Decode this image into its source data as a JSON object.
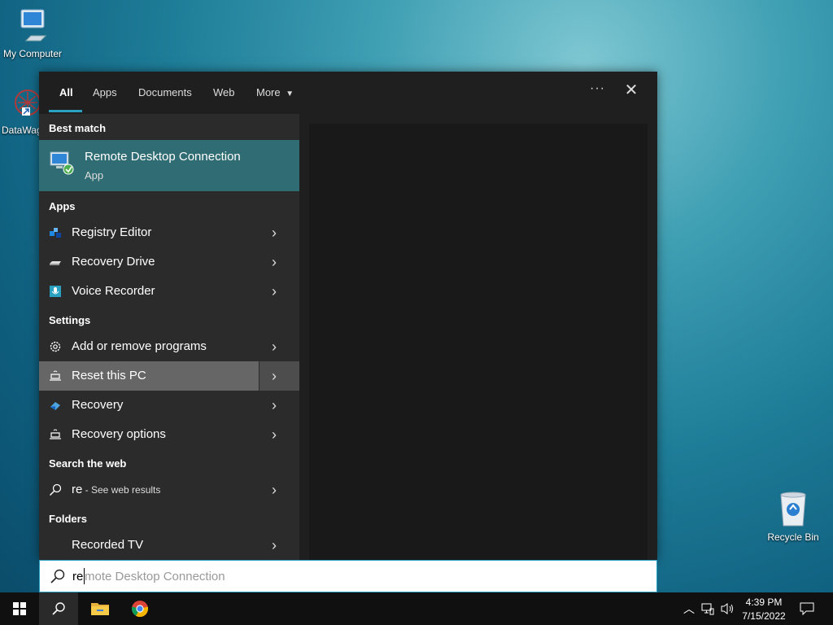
{
  "desktop": {
    "icons": [
      {
        "label": "My Computer"
      },
      {
        "label": "DataWag"
      },
      {
        "label": "Recycle Bin"
      }
    ]
  },
  "search_panel": {
    "tabs": [
      {
        "label": "All",
        "active": true
      },
      {
        "label": "Apps"
      },
      {
        "label": "Documents"
      },
      {
        "label": "Web"
      },
      {
        "label": "More"
      }
    ],
    "more_options_glyph": "···",
    "close_glyph": "✕",
    "best_match": {
      "heading": "Best match",
      "title": "Remote Desktop Connection",
      "subtitle": "App",
      "icon": "remote-desktop-icon"
    },
    "sections": {
      "apps": "Apps",
      "settings": "Settings",
      "web": "Search the web",
      "folders": "Folders"
    },
    "apps": [
      {
        "label": "Registry Editor",
        "icon": "registry-editor-icon"
      },
      {
        "label": "Recovery Drive",
        "icon": "recovery-drive-icon"
      },
      {
        "label": "Voice Recorder",
        "icon": "voice-recorder-icon"
      }
    ],
    "settings": [
      {
        "label": "Add or remove programs",
        "icon": "gear-icon"
      },
      {
        "label": "Reset this PC",
        "icon": "reset-pc-icon",
        "highlighted": true
      },
      {
        "label": "Recovery",
        "icon": "recovery-icon"
      },
      {
        "label": "Recovery options",
        "icon": "recovery-options-icon"
      }
    ],
    "web": {
      "query": "re",
      "suffix": " - See web results"
    },
    "folders": [
      {
        "label": "Recorded TV"
      }
    ]
  },
  "search_box": {
    "typed": "re",
    "suggestion_remainder": "mote Desktop Connection"
  },
  "taskbar": {
    "time": "4:39 PM",
    "date": "7/15/2022"
  },
  "colors": {
    "accent": "#2aa1c0",
    "best_match_bg": "#2f6c73",
    "panel_bg": "#2b2b2b",
    "highlight_bg": "#666666"
  }
}
